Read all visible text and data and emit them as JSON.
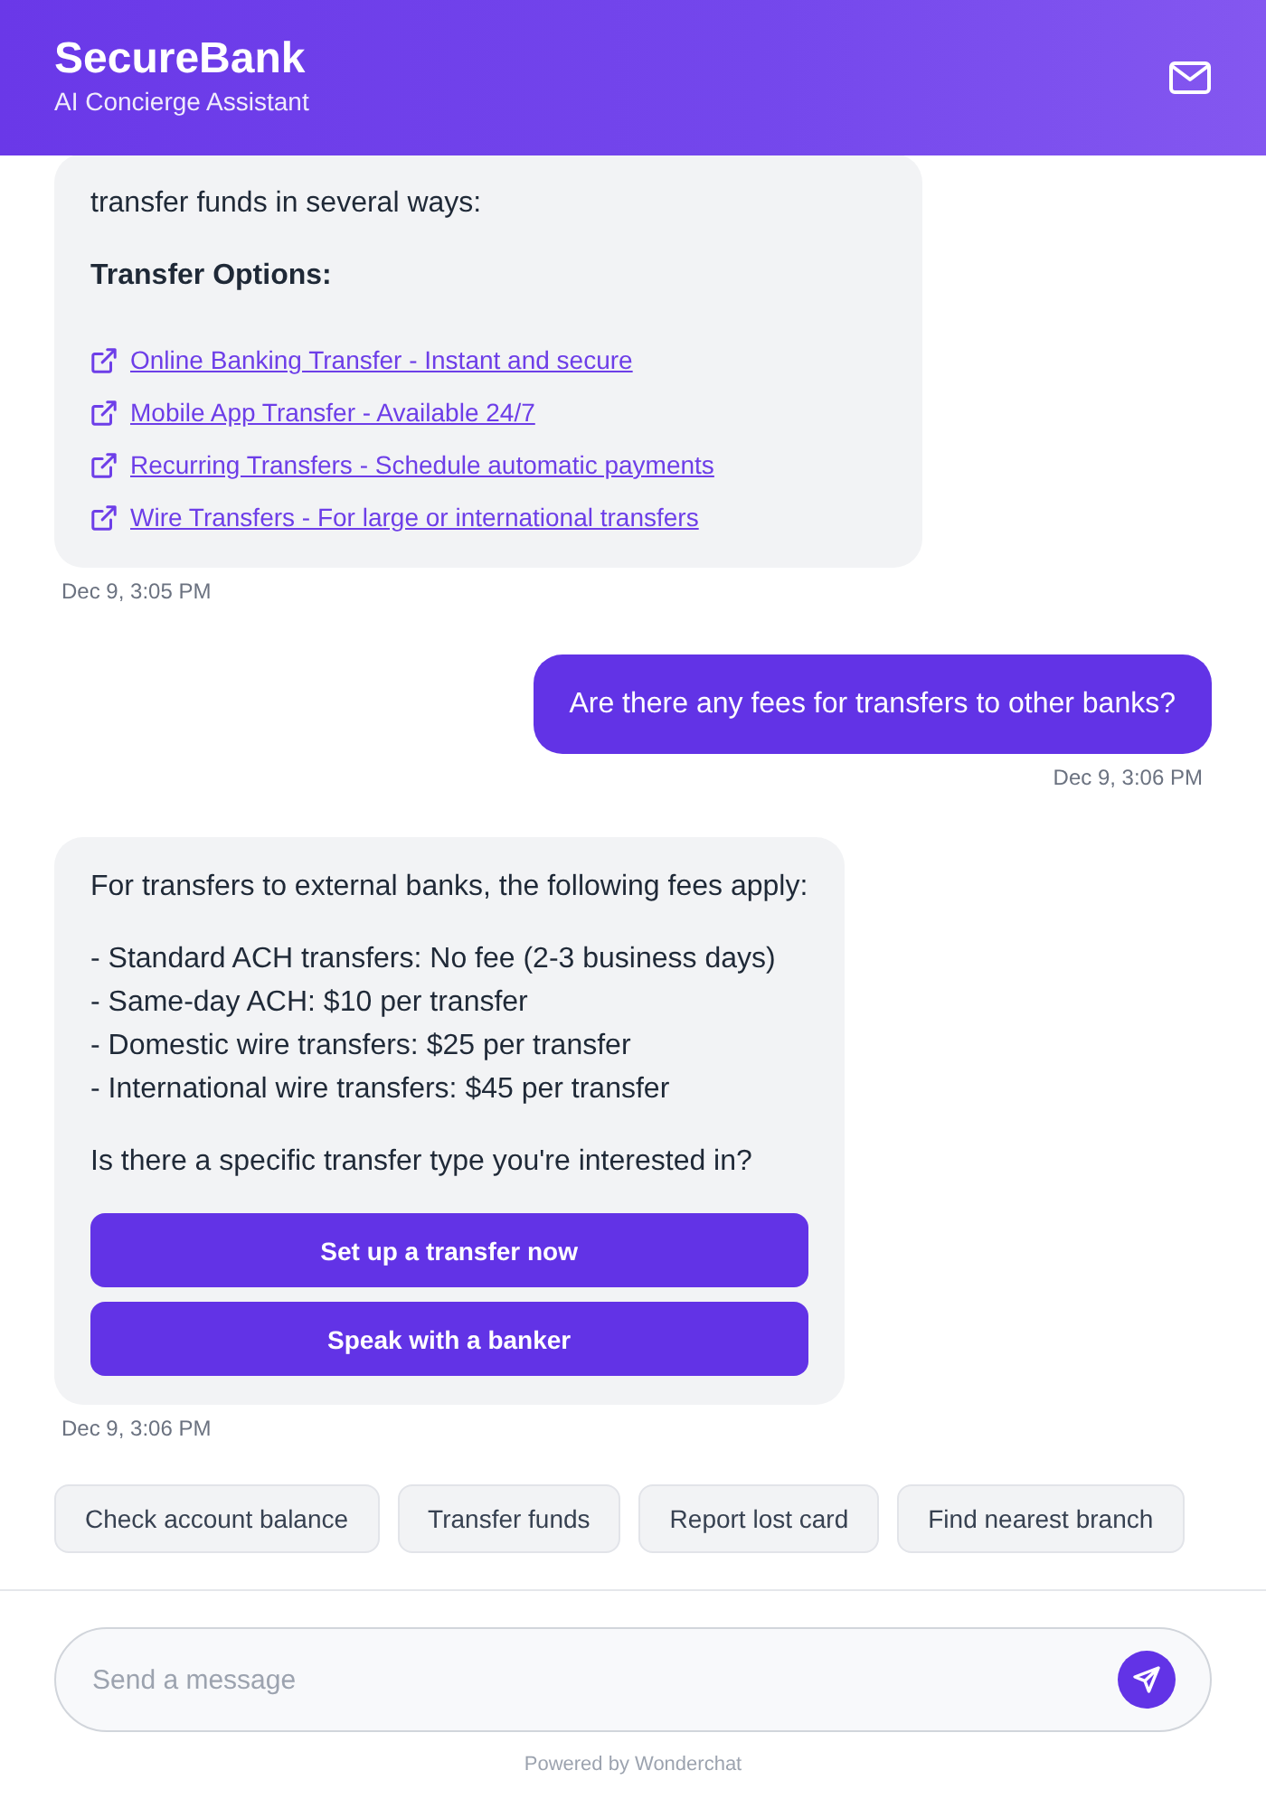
{
  "header": {
    "title": "SecureBank",
    "subtitle": "AI Concierge Assistant"
  },
  "messages": [
    {
      "kind": "bot",
      "time": "Dec 9, 3:05 PM",
      "blocks": [
        {
          "kind": "text",
          "text": "transfer funds in several ways:"
        },
        {
          "kind": "heading",
          "text": "Transfer Options:"
        },
        {
          "kind": "links",
          "items": [
            "Online Banking Transfer - Instant and secure",
            "Mobile App Transfer - Available 24/7",
            "Recurring Transfers - Schedule automatic payments",
            "Wire Transfers - For large or international transfers"
          ]
        }
      ]
    },
    {
      "kind": "user",
      "time": "Dec 9, 3:06 PM",
      "text": "Are there any fees for transfers to other banks?"
    },
    {
      "kind": "bot",
      "time": "Dec 9, 3:06 PM",
      "blocks": [
        {
          "kind": "text",
          "text": "For transfers to external banks, the following fees apply:"
        },
        {
          "kind": "lines",
          "items": [
            "- Standard ACH transfers: No fee (2-3 business days)",
            "- Same-day ACH: $10 per transfer",
            "- Domestic wire transfers: $25 per transfer",
            "- International wire transfers: $45 per transfer"
          ]
        },
        {
          "kind": "text",
          "text": "Is there a specific transfer type you're interested in?"
        },
        {
          "kind": "buttons",
          "items": [
            "Set up a transfer now",
            "Speak with a banker"
          ]
        }
      ]
    }
  ],
  "suggestions": [
    "Check account balance",
    "Transfer funds",
    "Report lost card",
    "Find nearest branch"
  ],
  "composer": {
    "placeholder": "Send a message"
  },
  "footer": "Powered by Wonderchat"
}
